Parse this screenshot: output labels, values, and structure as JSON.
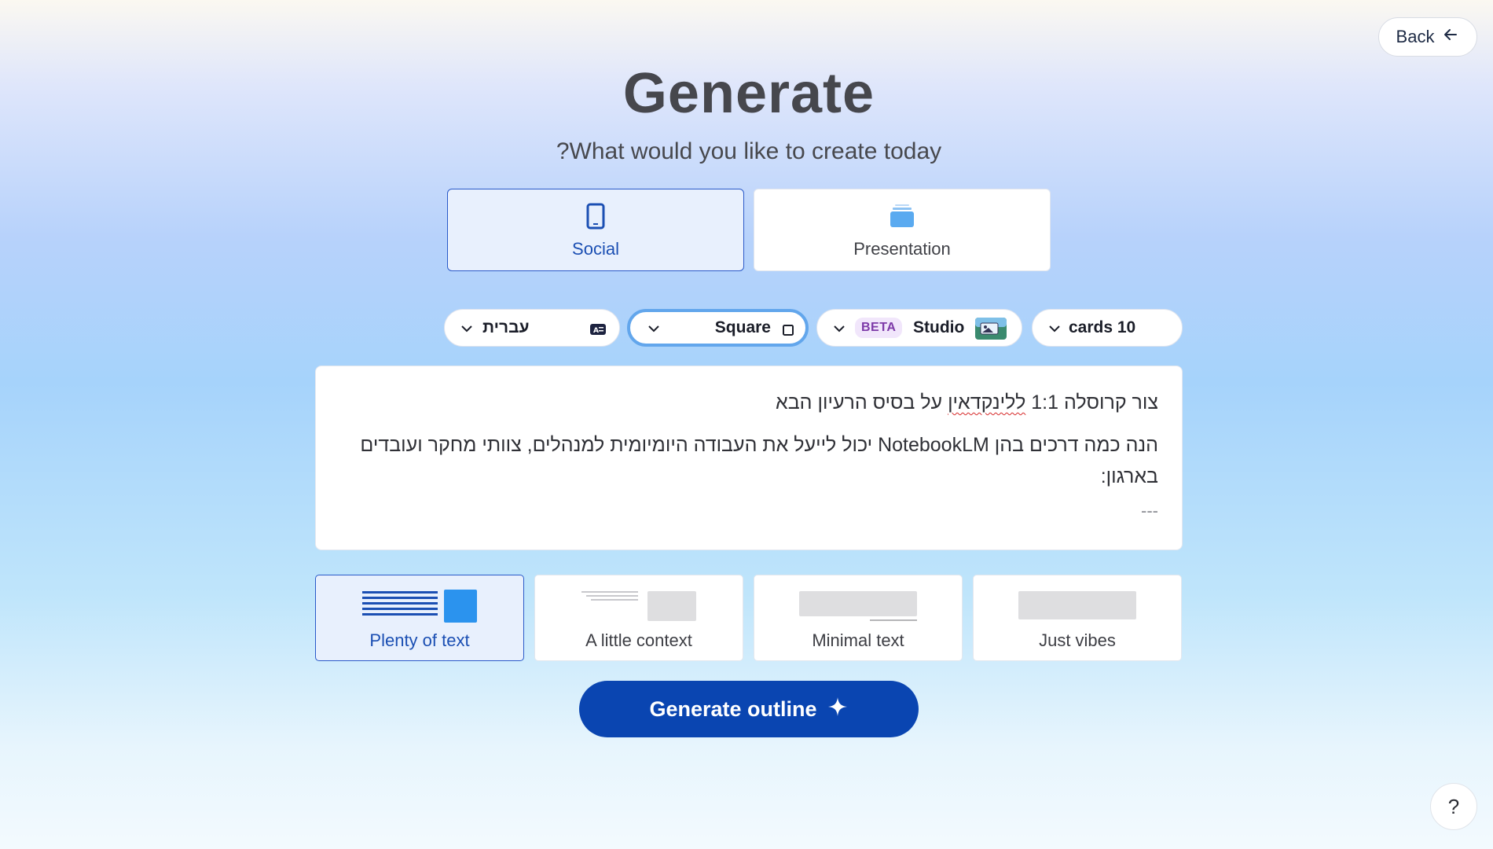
{
  "header": {
    "back_label": "Back",
    "back_icon": "arrow-left-icon",
    "title": "Generate",
    "subtitle": "?What would you like to create today"
  },
  "modes": [
    {
      "label": "Social",
      "icon": "smartphone-icon",
      "selected": true
    },
    {
      "label": "Presentation",
      "icon": "presentation-stack-icon",
      "selected": false
    }
  ],
  "options": {
    "language": {
      "value": "עברית",
      "icon": "language-icon"
    },
    "format": {
      "value": "Square",
      "icon": "square-icon"
    },
    "theme": {
      "badge": "BETA",
      "value": "Studio",
      "icon": "theme-thumbnail-icon"
    },
    "cards": {
      "value": "cards 10"
    }
  },
  "prompt": {
    "line1_before": "צור קרוסלה 1:1 ",
    "line1_misspelled": "ללינקדאין",
    "line1_after": " על בסיס הרעיון הבא",
    "line2": "הנה כמה דרכים בהן NotebookLM יכול לייעל את העבודה היומיומית למנהלים, צוותי מחקר ועובדים בארגון:",
    "separator": "---"
  },
  "density": [
    {
      "label": "Plenty of text",
      "selected": true
    },
    {
      "label": "A little context",
      "selected": false
    },
    {
      "label": "Minimal text",
      "selected": false
    },
    {
      "label": "Just vibes",
      "selected": false
    }
  ],
  "actions": {
    "generate_label": "Generate outline",
    "generate_icon": "sparkle-icon",
    "help_label": "?"
  },
  "colors": {
    "accent": "#0a45b1",
    "selected_border": "#2a5ac9",
    "selected_bg": "#e8f0fd",
    "beta_bg": "#f1e6fb",
    "beta_text": "#7d3aa8"
  }
}
